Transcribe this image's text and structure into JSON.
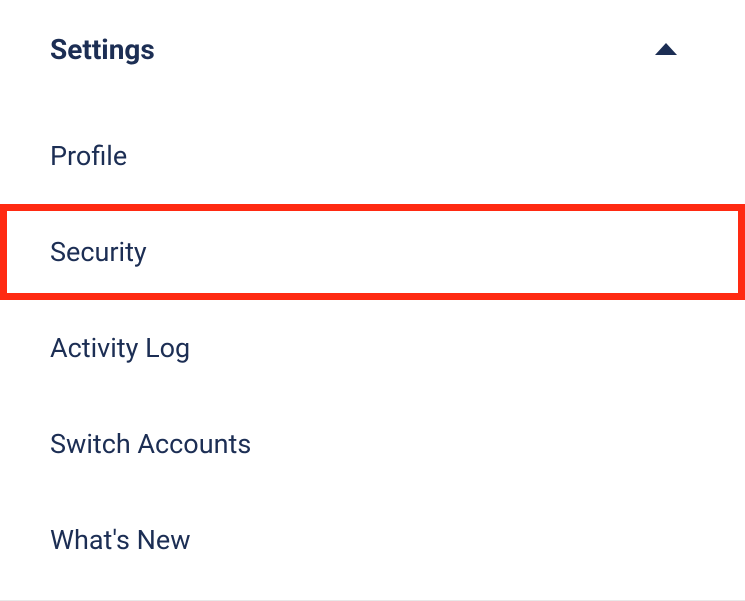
{
  "settings": {
    "title": "Settings",
    "items": [
      {
        "label": "Profile",
        "highlighted": false
      },
      {
        "label": "Security",
        "highlighted": true
      },
      {
        "label": "Activity Log",
        "highlighted": false
      },
      {
        "label": "Switch Accounts",
        "highlighted": false
      },
      {
        "label": "What's New",
        "highlighted": false
      }
    ]
  }
}
